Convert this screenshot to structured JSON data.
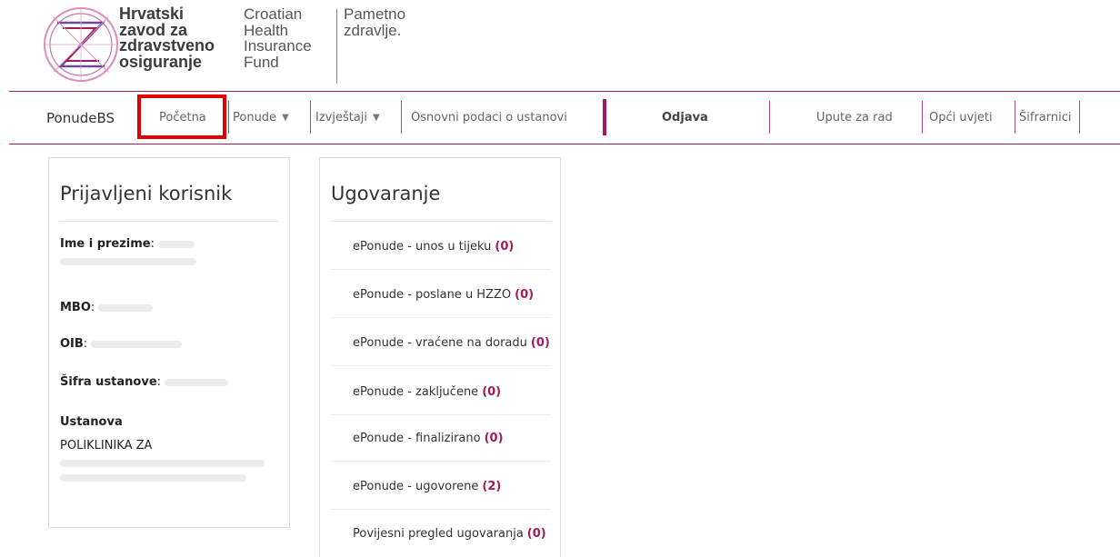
{
  "logo": {
    "name_hr": [
      "Hrvatski",
      "zavod za",
      "zdravstveno",
      "osiguranje"
    ],
    "name_en": [
      "Croatian",
      "Health",
      "Insurance",
      "Fund"
    ],
    "tagline": [
      "Pametno",
      "zdravlje."
    ],
    "colors": {
      "magenta": "#a3195b",
      "purple": "#6b4aa0",
      "pink": "#e08ab8"
    }
  },
  "navbar": {
    "brand": "PonudeBS",
    "items": [
      {
        "label": "Početna"
      },
      {
        "label": "Ponude",
        "dropdown": true
      },
      {
        "label": "Izvještaji",
        "dropdown": true
      },
      {
        "label": "Osnovni podaci o ustanovi"
      },
      {
        "label": "Odjava"
      },
      {
        "label": "Upute za rad"
      },
      {
        "label": "Opći uvjeti"
      },
      {
        "label": "Šifrarnici"
      }
    ],
    "accent_color": "#a3195b",
    "highlight_color": "#e00000"
  },
  "user_panel": {
    "title": "Prijavljeni korisnik",
    "fields": [
      {
        "label": "Ime i prezime",
        "value": ""
      },
      {
        "label": "MBO",
        "value": ""
      },
      {
        "label": "OIB",
        "value": ""
      },
      {
        "label": "Šifra ustanove",
        "value": ""
      }
    ],
    "institution_label": "Ustanova",
    "institution_value": "POLIKLINIKA ZA"
  },
  "contract_panel": {
    "title": "Ugovaranje",
    "items": [
      {
        "label": "ePonude - unos u tijeku",
        "count": "(0)"
      },
      {
        "label": "ePonude - poslane u HZZO",
        "count": "(0)"
      },
      {
        "label": "ePonude - vraćene na doradu",
        "count": "(0)"
      },
      {
        "label": "ePonude - zaključene",
        "count": "(0)"
      },
      {
        "label": "ePonude - finalizirano",
        "count": "(0)"
      },
      {
        "label": "ePonude - ugovorene",
        "count": "(2)"
      },
      {
        "label": "Povijesni pregled ugovaranja",
        "count": "(0)"
      }
    ]
  }
}
